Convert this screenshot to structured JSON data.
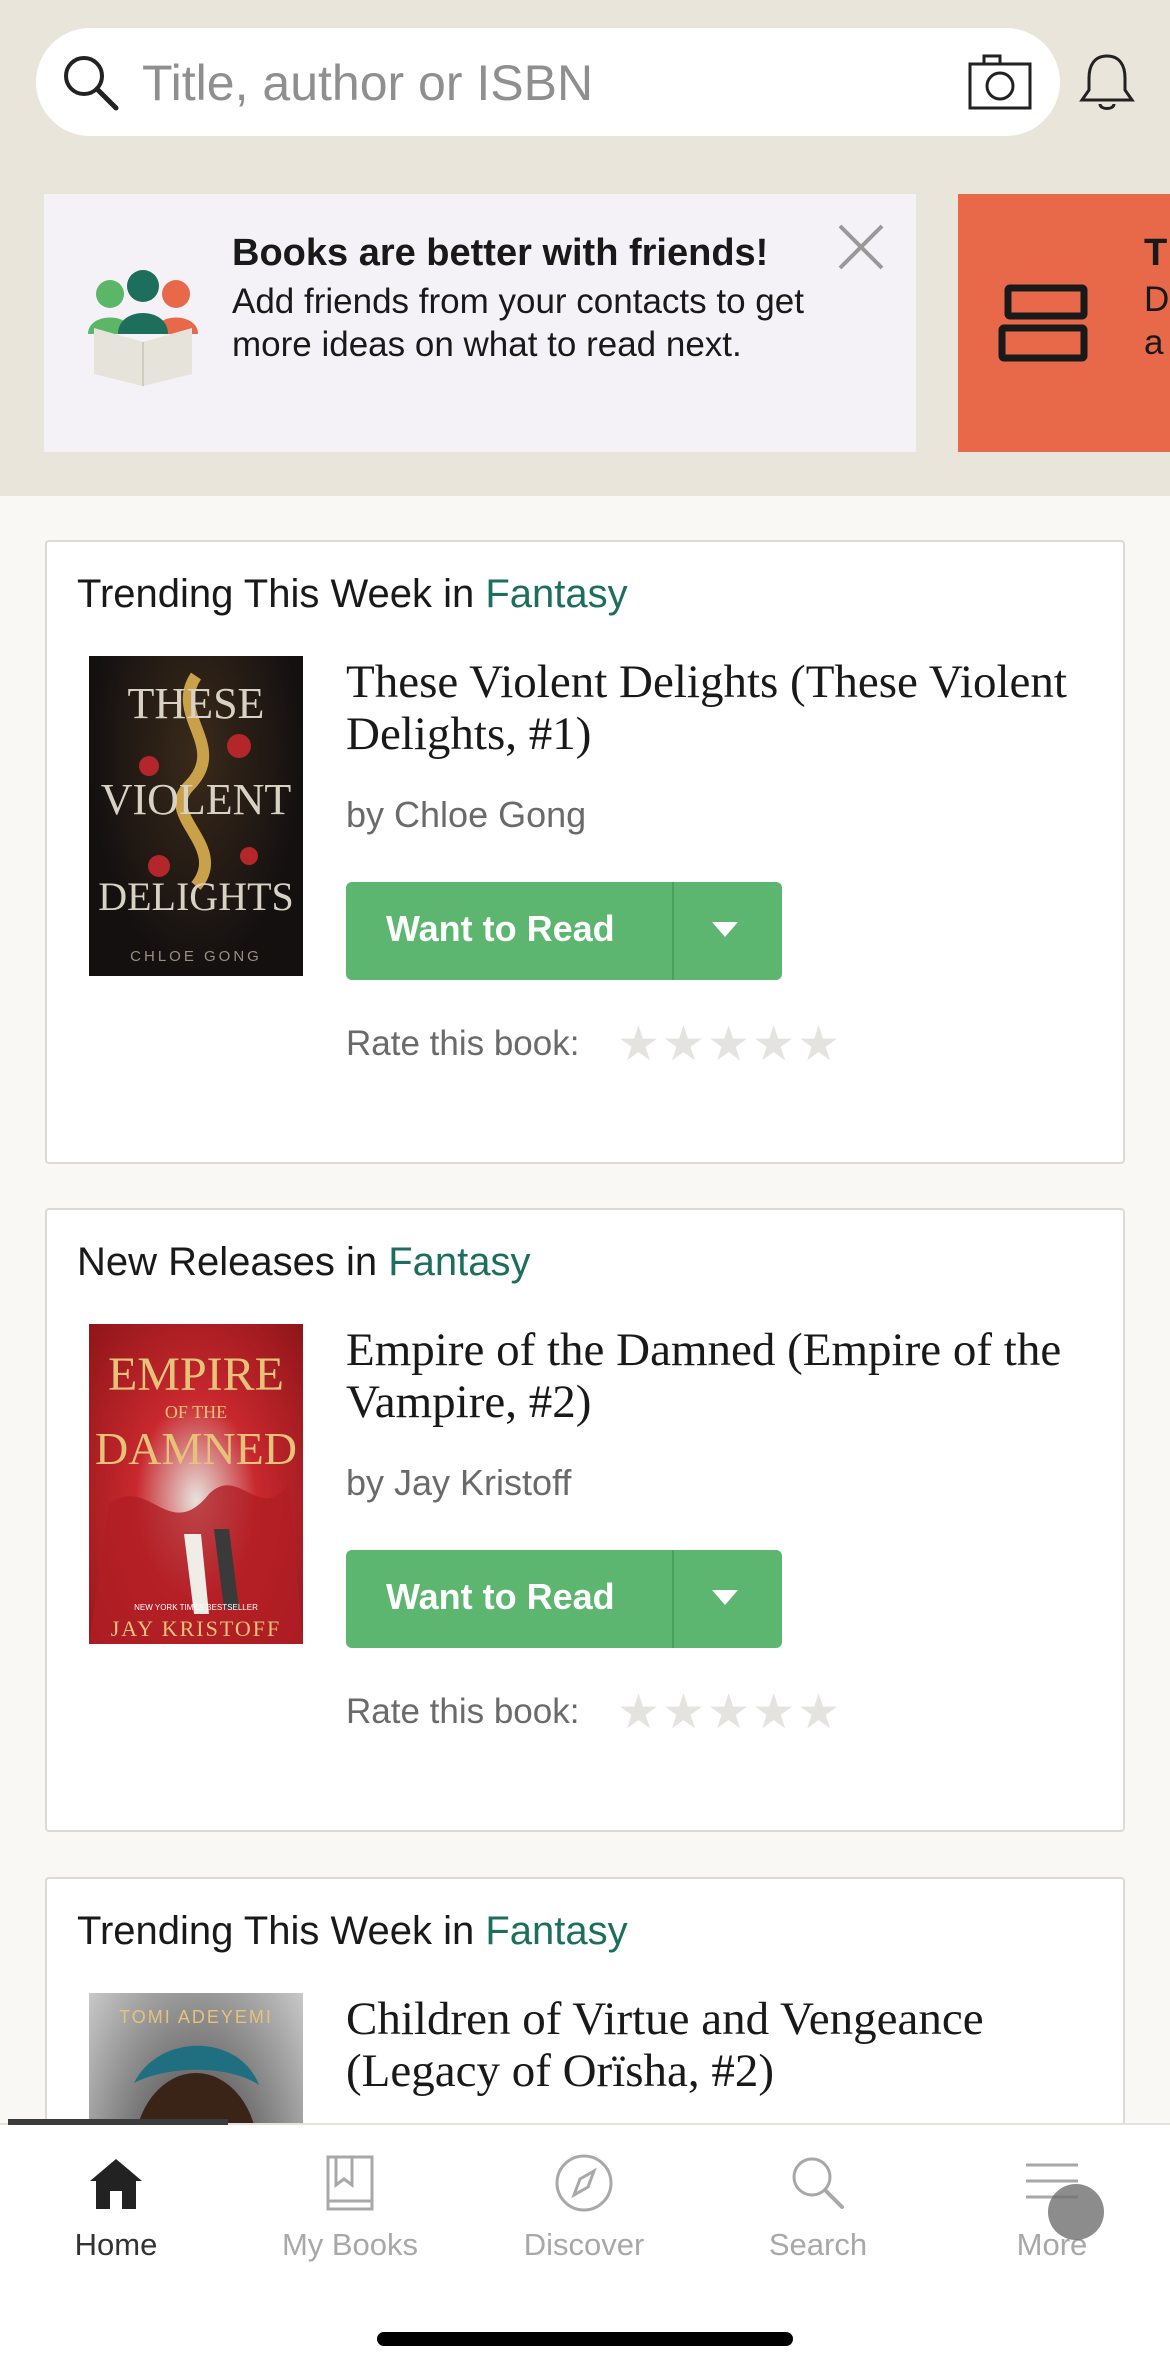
{
  "search": {
    "placeholder": "Title, author or ISBN"
  },
  "promo": {
    "title": "Books are better with friends!",
    "body": "Add friends from your contacts to get more ideas on what to read next."
  },
  "promo2": {
    "title_partial": "T",
    "line1_partial": "D",
    "line2_partial": "a"
  },
  "cards": [
    {
      "heading_prefix": "Trending This Week in ",
      "genre": "Fantasy",
      "title": "These Violent Delights (These Violent Delights, #1)",
      "author": "by Chloe Gong",
      "cover": {
        "line1": "THESE",
        "line2": "VIOLENT",
        "line3": "DELIGHTS",
        "author": "CHLOE GONG"
      },
      "button": "Want to Read",
      "rate_label": "Rate this book:",
      "rating_value": 0,
      "rating_max": 5
    },
    {
      "heading_prefix": "New Releases in ",
      "genre": "Fantasy",
      "title": "Empire of the Damned (Empire of the Vampire, #2)",
      "author": "by Jay Kristoff",
      "cover": {
        "line1": "EMPIRE",
        "line2": "OF THE",
        "line3": "DAMNED",
        "tag": "NEW YORK TIMES BESTSELLER",
        "author": "JAY KRISTOFF"
      },
      "button": "Want to Read",
      "rate_label": "Rate this book:",
      "rating_value": 0,
      "rating_max": 5
    },
    {
      "heading_prefix": "Trending This Week in ",
      "genre": "Fantasy",
      "title": "Children of Virtue and Vengeance (Legacy of Orïsha, #2)",
      "cover": {
        "author": "TOMI ADEYEMI"
      }
    }
  ],
  "tabs": [
    {
      "label": "Home",
      "icon": "home-icon",
      "active": true
    },
    {
      "label": "My Books",
      "icon": "my-books-icon",
      "active": false
    },
    {
      "label": "Discover",
      "icon": "compass-icon",
      "active": false
    },
    {
      "label": "Search",
      "icon": "search-icon",
      "active": false
    },
    {
      "label": "More",
      "icon": "menu-icon",
      "active": false
    }
  ],
  "colors": {
    "genre_link": "#1d6e5d",
    "want_to_read": "#5cb66f",
    "promo_alt": "#e8694a",
    "header_bg": "#e9e5da"
  }
}
